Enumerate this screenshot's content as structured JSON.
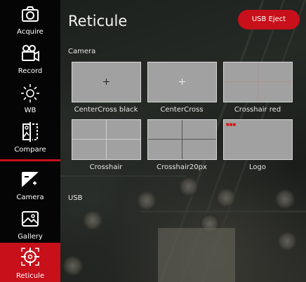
{
  "sidebar": {
    "items": [
      {
        "label": "Acquire",
        "icon": "camera-icon"
      },
      {
        "label": "Record",
        "icon": "video-camera-icon"
      },
      {
        "label": "WB",
        "icon": "sun-icon"
      },
      {
        "label": "Compare",
        "icon": "compare-image-icon"
      },
      {
        "label": "Camera",
        "icon": "exposure-icon"
      },
      {
        "label": "Gallery",
        "icon": "gallery-image-icon"
      },
      {
        "label": "Reticule",
        "icon": "crosshair-icon",
        "active": true
      }
    ]
  },
  "header": {
    "title": "Reticule",
    "eject_label": "USB Eject"
  },
  "sections": {
    "camera": "Camera",
    "usb": "USB"
  },
  "reticules": [
    {
      "label": "CenterCross black"
    },
    {
      "label": "CenterCross"
    },
    {
      "label": "Crosshair red"
    },
    {
      "label": "Crosshair"
    },
    {
      "label": "Crosshair20px"
    },
    {
      "label": "Logo"
    }
  ],
  "colors": {
    "accent": "#c8101a",
    "sidebar_bg": "#050505",
    "tile_bg": "#a1a1a1"
  }
}
